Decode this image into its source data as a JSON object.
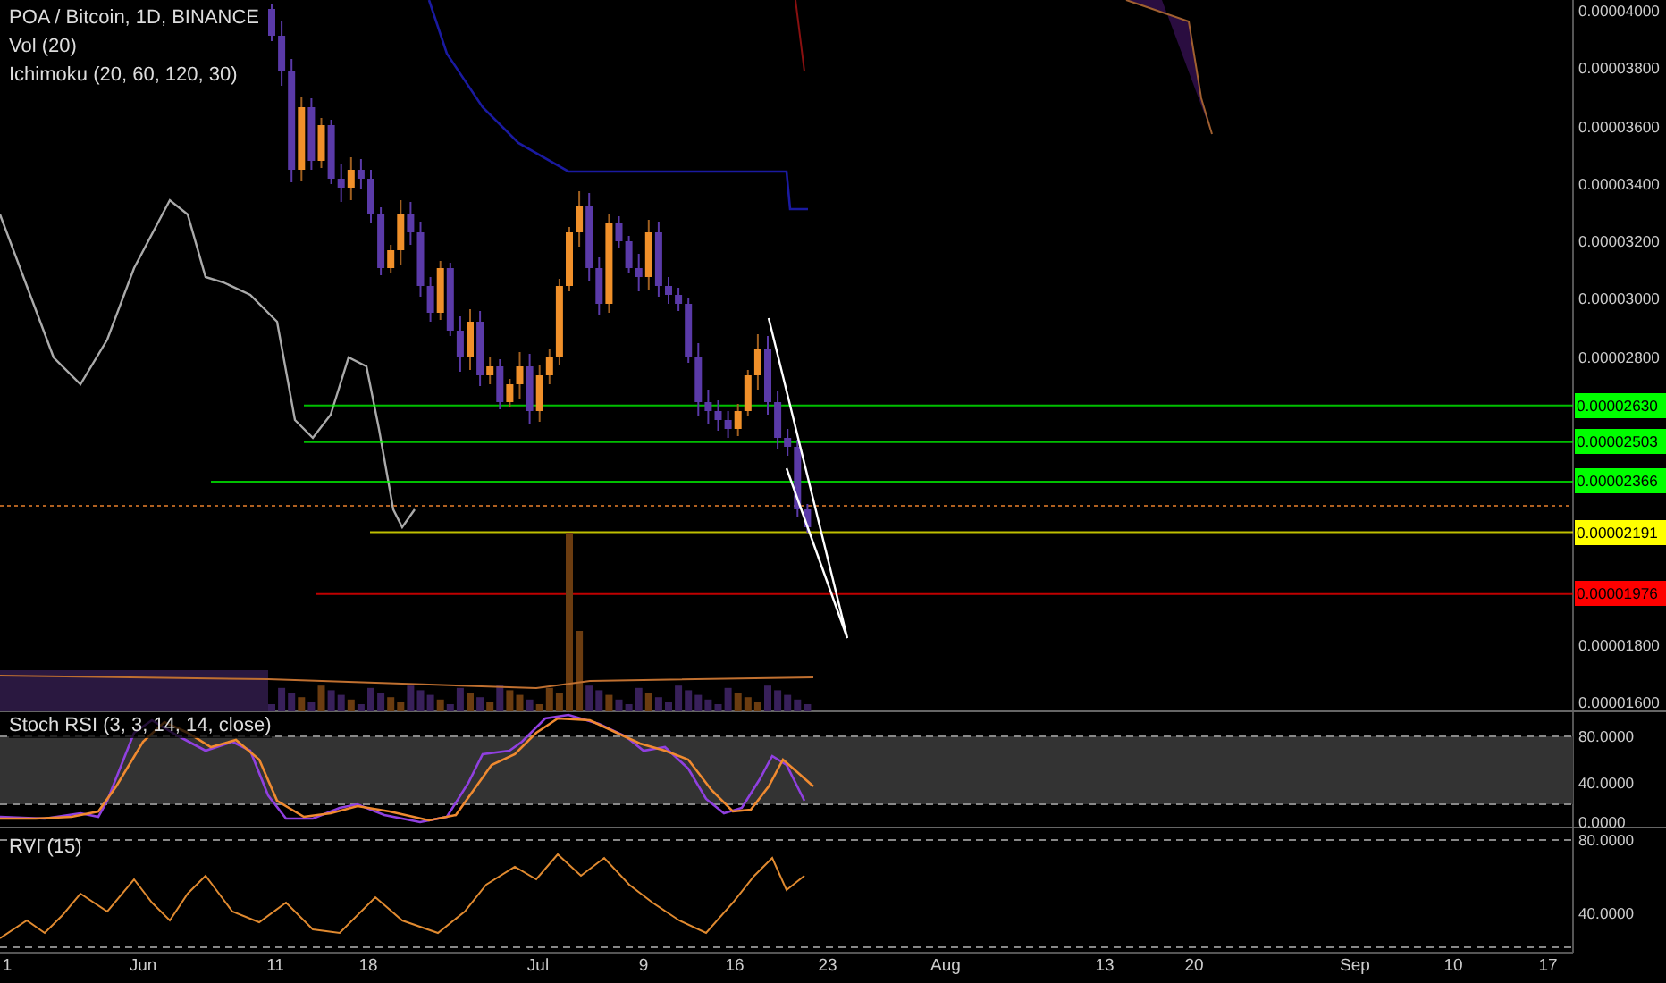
{
  "legend": [
    "POA / Bitcoin, 1D, BINANCE",
    "Vol (20)",
    "Ichimoku (20, 60, 120, 30)"
  ],
  "price_axis": {
    "ticks": [
      "0.00004000",
      "0.00003800",
      "0.00003600",
      "0.00003400",
      "0.00003200",
      "0.00003000",
      "0.00002800",
      "0.00001800",
      "0.00001600"
    ],
    "badges": [
      {
        "value": "0.00002630",
        "color": "#00ff00"
      },
      {
        "value": "0.00002503",
        "color": "#00ff00"
      },
      {
        "value": "0.00002366",
        "color": "#00ff00"
      },
      {
        "value": "0.00002191",
        "color": "#ffff00"
      },
      {
        "value": "0.00001976",
        "color": "#ff0000"
      }
    ]
  },
  "stoch_rsi": {
    "title": "Stoch RSI (3, 3, 14, 14, close)",
    "ticks": [
      "80.0000",
      "40.0000",
      "0.0000"
    ]
  },
  "rvi": {
    "title": "RVI (15)",
    "ticks": [
      "80.0000",
      "40.0000"
    ]
  },
  "time_axis": [
    "1",
    "Jun",
    "11",
    "18",
    "Jul",
    "9",
    "16",
    "23",
    "Aug",
    "13",
    "20",
    "Sep",
    "10",
    "17"
  ]
}
